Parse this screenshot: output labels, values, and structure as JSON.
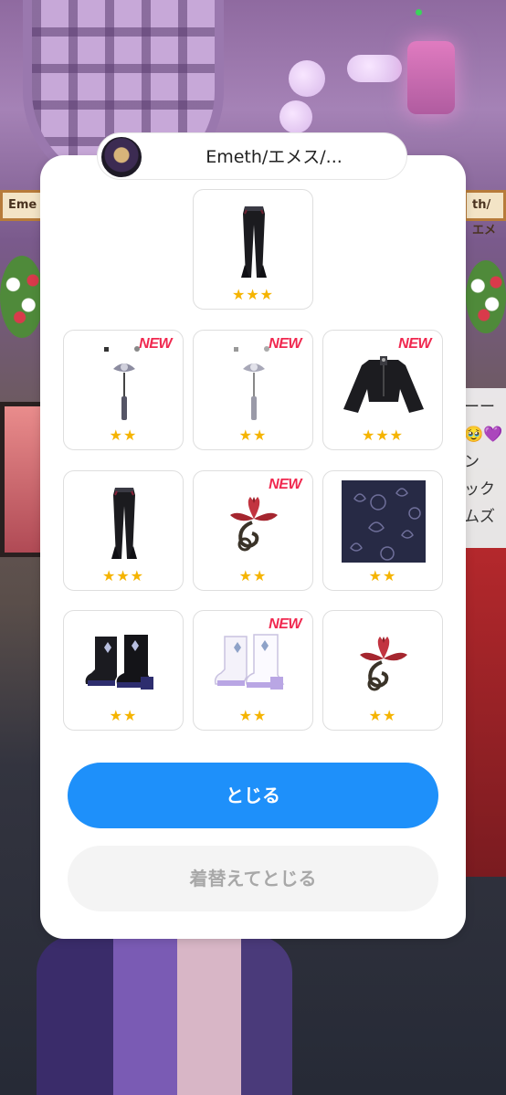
{
  "background": {
    "left_banner_text": "Eme",
    "right_banner_text": "th/エメ",
    "chat_lines": [
      "ーー",
      "🥹💜",
      "ン",
      "ック",
      "ムズ"
    ]
  },
  "profile": {
    "name": "Emeth/エメス/..."
  },
  "items": [
    {
      "icon": "black-flared-pants-icon",
      "stars": "★★★",
      "new_label": ""
    },
    {
      "icon": "tassel-hairpin-icon",
      "stars": "★★",
      "new_label": "NEW"
    },
    {
      "icon": "tassel-hairpin-icon",
      "stars": "★★",
      "new_label": "NEW"
    },
    {
      "icon": "black-bell-sleeve-top-icon",
      "stars": "★★★",
      "new_label": "NEW"
    },
    {
      "icon": "black-flared-pants-icon",
      "stars": "★★★",
      "new_label": ""
    },
    {
      "icon": "red-lotus-sticker-icon",
      "stars": "★★",
      "new_label": "NEW"
    },
    {
      "icon": "lotus-pattern-background-icon",
      "stars": "★★",
      "new_label": ""
    },
    {
      "icon": "black-ankle-boots-icon",
      "stars": "★★",
      "new_label": ""
    },
    {
      "icon": "white-ankle-boots-icon",
      "stars": "★★",
      "new_label": "NEW"
    },
    {
      "icon": "red-lotus-sticker-icon",
      "stars": "★★",
      "new_label": ""
    }
  ],
  "buttons": {
    "close_label": "とじる",
    "change_and_close_label": "着替えてとじる"
  },
  "colors": {
    "primary_button": "#1e90fa",
    "secondary_button": "#f4f4f4",
    "new_badge": "#f0284f",
    "star": "#f5b400"
  }
}
